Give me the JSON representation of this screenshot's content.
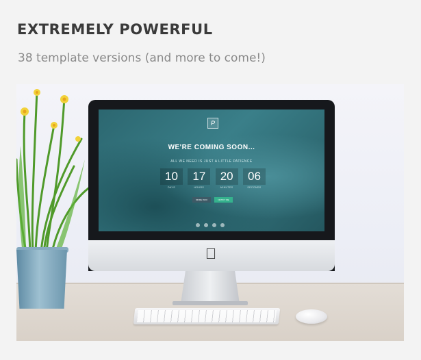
{
  "header": {
    "title": "EXTREMELY POWERFUL",
    "subtitle": "38 template versions (and more to come!)"
  },
  "screen": {
    "logo_letter": "P",
    "title": "WE'RE COMING SOON...",
    "subtitle": "ALL WE NEED IS JUST A LITTLE PATIENCE",
    "countdown": [
      {
        "value": "10",
        "label": "DAYS"
      },
      {
        "value": "17",
        "label": "HOURS"
      },
      {
        "value": "20",
        "label": "MINUTES"
      },
      {
        "value": "06",
        "label": "SECONDS"
      }
    ],
    "buttons": {
      "more": "MORE INFO",
      "notify": "NOTIFY ME"
    }
  },
  "colors": {
    "accent": "#35b28d",
    "screen_teal": "#2c6770"
  }
}
